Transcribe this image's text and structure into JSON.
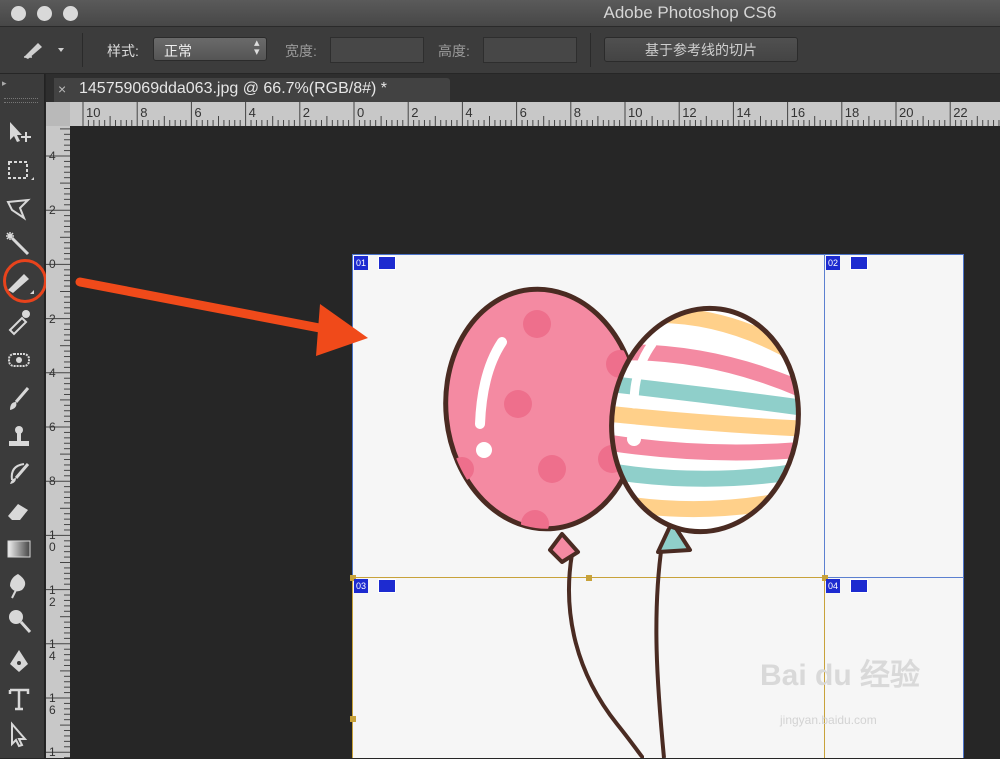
{
  "window": {
    "title": "Adobe Photoshop CS6",
    "traffic_lights": [
      "close",
      "minimize",
      "zoom"
    ]
  },
  "options_bar": {
    "tool_icon": "slice-tool-icon",
    "style_label": "样式:",
    "style_value": "正常",
    "width_label": "宽度:",
    "width_value": "",
    "height_label": "高度:",
    "height_value": "",
    "slices_from_guides_label": "基于参考线的切片"
  },
  "document_tab": {
    "close_symbol": "×",
    "title": "145759069dda063.jpg @ 66.7%(RGB/8#) *"
  },
  "rulers": {
    "horizontal": [
      "10",
      "8",
      "6",
      "4",
      "2",
      "0",
      "2",
      "4",
      "6",
      "8",
      "10",
      "12",
      "14",
      "16",
      "18",
      "20",
      "22"
    ],
    "vertical": [
      "4",
      "2",
      "0",
      "2",
      "4",
      "6",
      "8",
      "1\n0",
      "1\n2",
      "1\n4",
      "1\n6",
      "1"
    ]
  },
  "tools": [
    "move-tool-icon",
    "marquee-tool-icon",
    "lasso-tool-icon",
    "magic-wand-tool-icon",
    "slice-tool-icon",
    "eyedropper-tool-icon",
    "healing-brush-tool-icon",
    "brush-tool-icon",
    "clone-stamp-tool-icon",
    "history-brush-tool-icon",
    "eraser-tool-icon",
    "gradient-tool-icon",
    "blur-tool-icon",
    "dodge-tool-icon",
    "pen-tool-icon",
    "type-tool-icon",
    "path-selection-tool-icon"
  ],
  "slices": [
    {
      "id": "01"
    },
    {
      "id": "02"
    },
    {
      "id": "03"
    },
    {
      "id": "04"
    }
  ],
  "annotation": {
    "highlight_color": "#e8431c",
    "arrow_color": "#f04a1a"
  },
  "watermark": {
    "brand": "Bai du 经验",
    "url": "jingyan.baidu.com"
  }
}
